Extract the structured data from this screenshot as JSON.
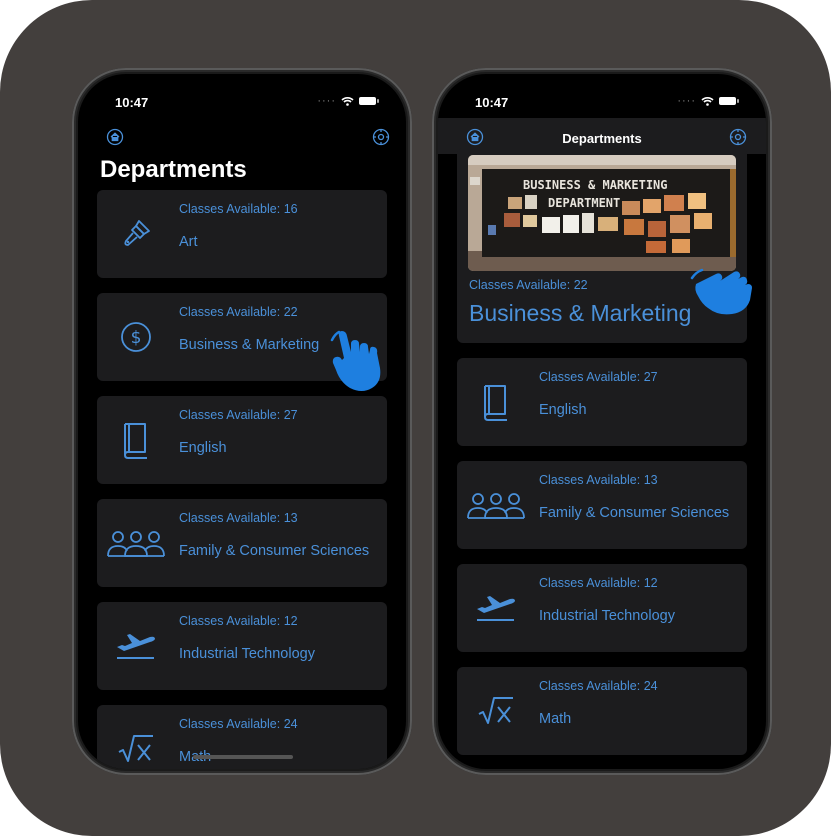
{
  "status": {
    "time": "10:47"
  },
  "left_screen": {
    "title": "Departments",
    "items": [
      {
        "sub": "Classes Available: 16",
        "name": "Art",
        "icon": "paintbrush-icon"
      },
      {
        "sub": "Classes Available: 22",
        "name": "Business & Marketing",
        "icon": "dollar-icon"
      },
      {
        "sub": "Classes Available: 27",
        "name": "English",
        "icon": "book-icon"
      },
      {
        "sub": "Classes Available: 13",
        "name": "Family & Consumer Sciences",
        "icon": "people-icon"
      },
      {
        "sub": "Classes Available: 12",
        "name": "Industrial Technology",
        "icon": "airplane-icon"
      },
      {
        "sub": "Classes Available: 24",
        "name": "Math",
        "icon": "sqrt-icon"
      }
    ]
  },
  "right_screen": {
    "nav_title": "Departments",
    "featured": {
      "sub": "Classes Available: 22",
      "name": "Business & Marketing",
      "photo_text_1": "BUSINESS & MARKETING",
      "photo_text_2": "DEPARTMENT"
    },
    "items": [
      {
        "sub": "Classes Available: 27",
        "name": "English",
        "icon": "book-icon"
      },
      {
        "sub": "Classes Available: 13",
        "name": "Family & Consumer Sciences",
        "icon": "people-icon"
      },
      {
        "sub": "Classes Available: 12",
        "name": "Industrial Technology",
        "icon": "airplane-icon"
      },
      {
        "sub": "Classes Available: 24",
        "name": "Math",
        "icon": "sqrt-icon"
      }
    ]
  },
  "colors": {
    "accent": "#4a90d9",
    "background": "#433f3d",
    "card": "#1c1c1e",
    "hand": "#1e7fe0"
  }
}
